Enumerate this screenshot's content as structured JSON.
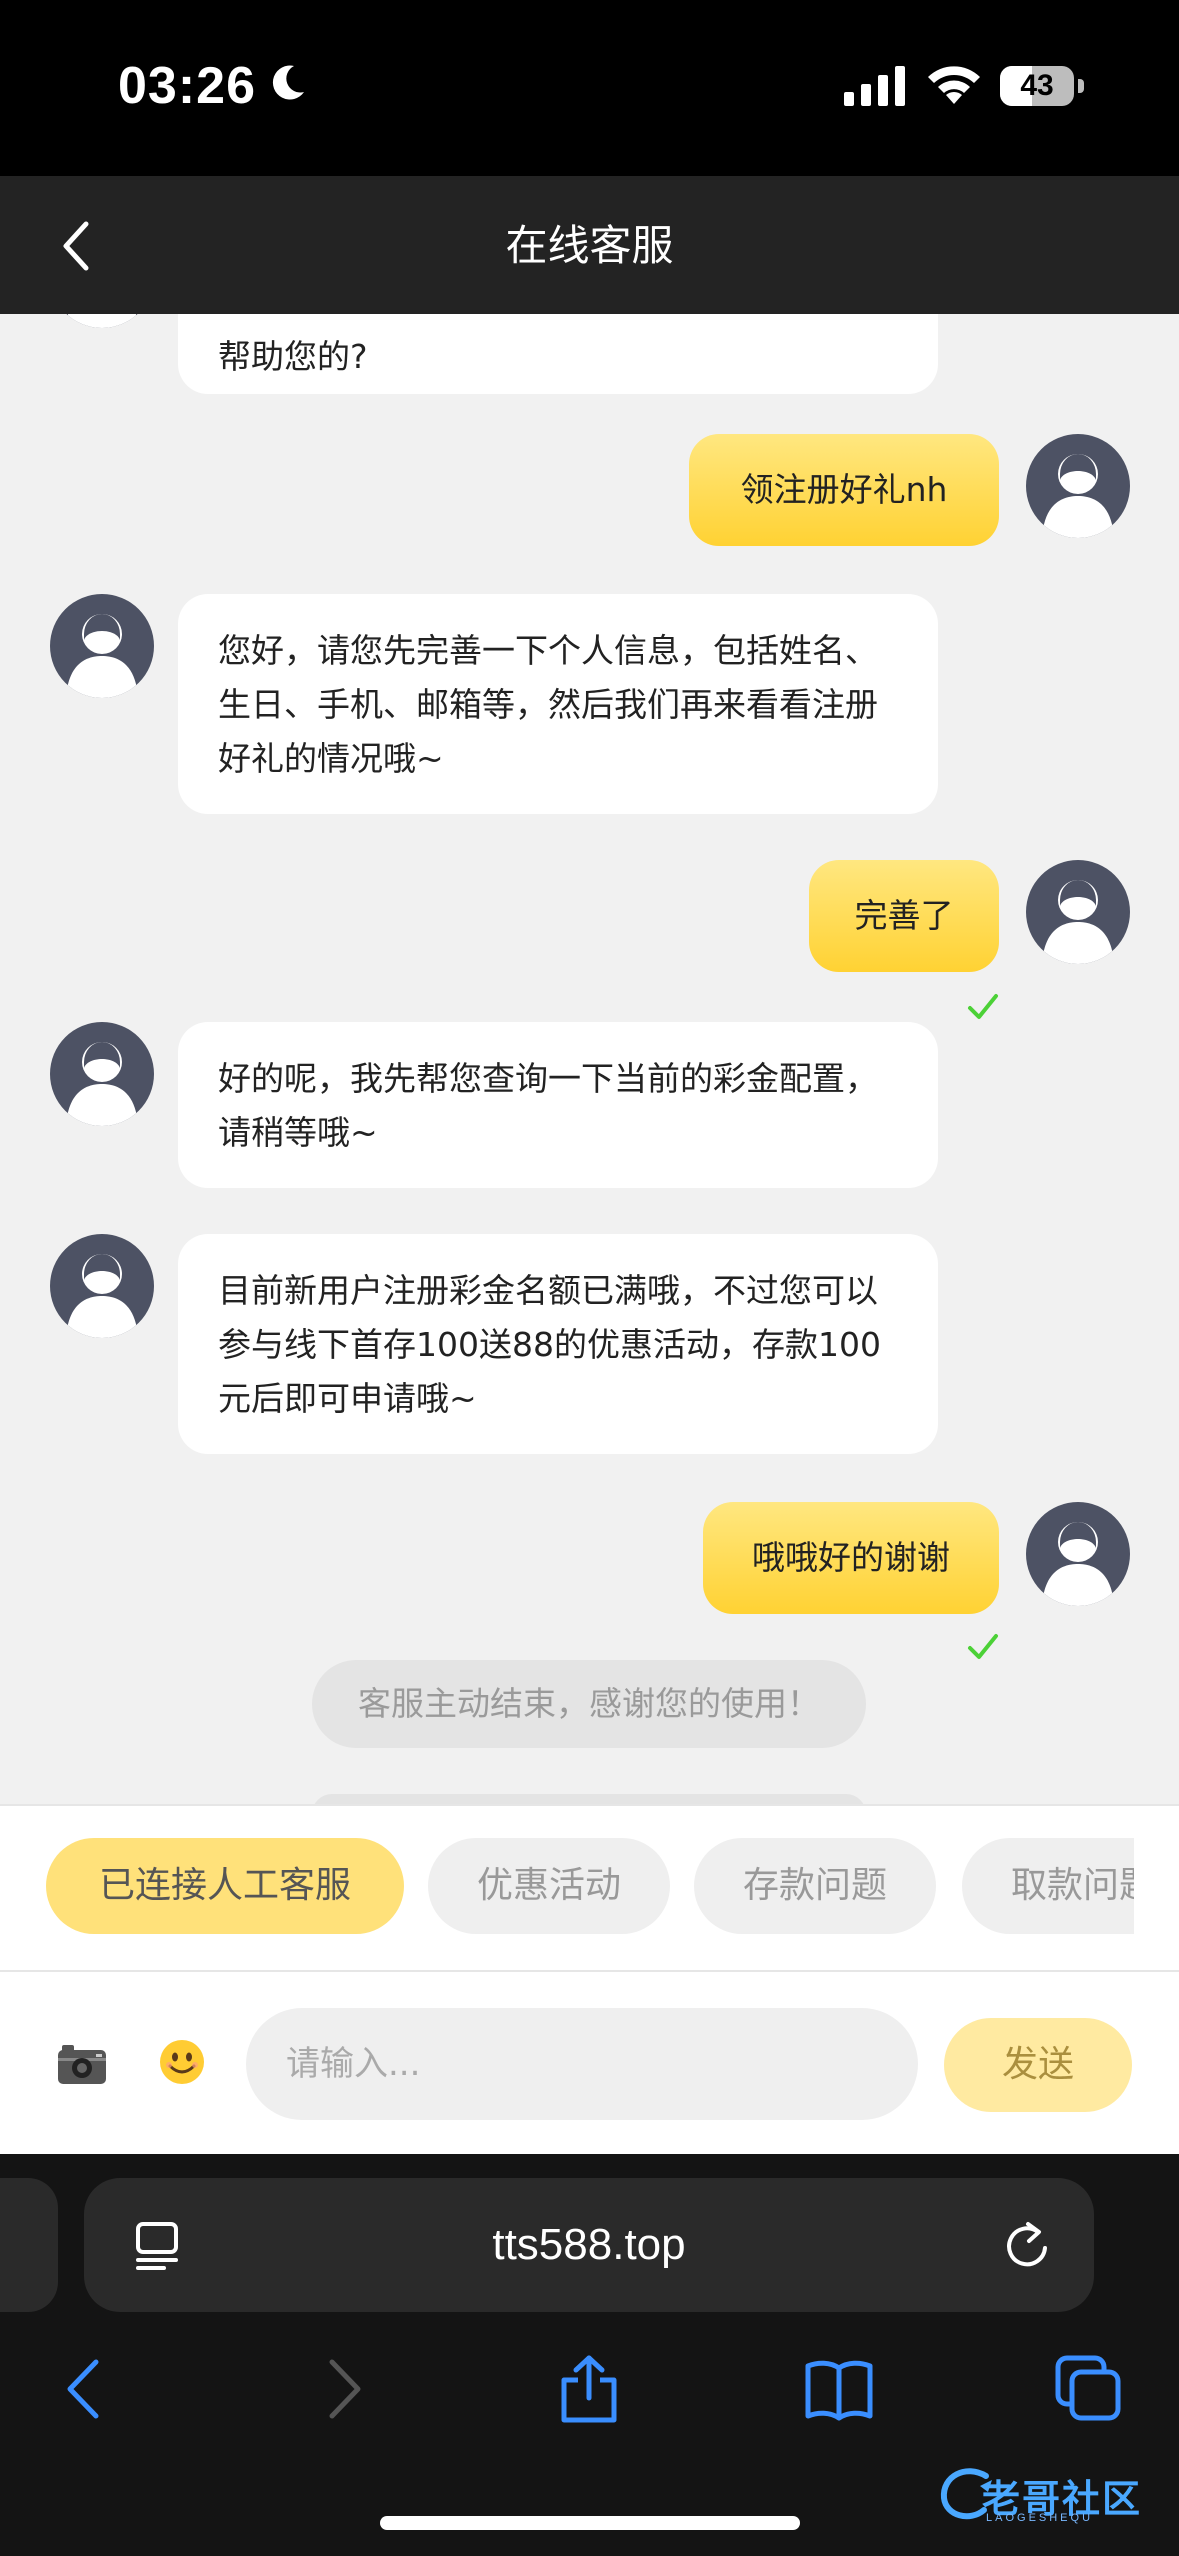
{
  "status_bar": {
    "time": "03:26",
    "battery": "43"
  },
  "nav": {
    "title": "在线客服"
  },
  "messages": [
    {
      "from": "agent",
      "text": "帮助您的?"
    },
    {
      "from": "user",
      "text": "领注册好礼nh"
    },
    {
      "from": "agent",
      "text": "您好，请您先完善一下个人信息，包括姓名、生日、手机、邮箱等，然后我们再来看看注册好礼的情况哦~"
    },
    {
      "from": "user",
      "text": "完善了"
    },
    {
      "from": "agent",
      "text": "好的呢，我先帮您查询一下当前的彩金配置，请稍等哦~"
    },
    {
      "from": "agent",
      "text": "目前新用户注册彩金名额已满哦，不过您可以参与线下首存100送88的优惠活动，存款100元后即可申请哦~"
    },
    {
      "from": "user",
      "text": "哦哦好的谢谢"
    }
  ],
  "system_notice": "客服主动结束，感谢您的使用！",
  "quick_actions": [
    "已连接人工客服",
    "优惠活动",
    "存款问题",
    "取款问题"
  ],
  "input": {
    "placeholder": "请输入...",
    "send_label": "发送"
  },
  "browser": {
    "url": "tts588.top"
  },
  "watermark": {
    "text": "老哥社区",
    "sub": "LAOGESHEQU"
  },
  "colors": {
    "accent": "#ffd233",
    "check": "#4cd137",
    "nav_bg": "#232323",
    "link_blue": "#3a8eff"
  }
}
